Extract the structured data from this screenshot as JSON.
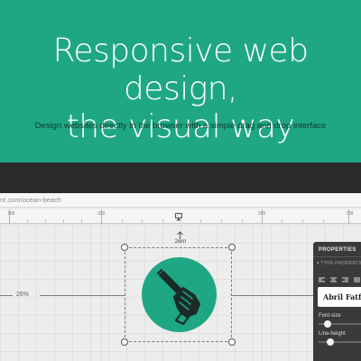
{
  "hero": {
    "title_line1": "Responsive web design,",
    "title_line2": "the visual way",
    "subtitle": "Design websites directly in the browser with a simple drag and drop interface"
  },
  "browser": {
    "url": "nt.com/ocean-beach"
  },
  "ruler": {
    "labels": [
      "768",
      "320",
      "320",
      "768"
    ]
  },
  "canvas": {
    "width_percent": "26%",
    "top_margin": "2em"
  },
  "panel": {
    "header": "PROPERTIES",
    "section": "▾ TYPE PROPERTIES",
    "font_name": "Abril Fatface",
    "font_size_label": "Font-size",
    "line_height_label": "Line-height",
    "font_size_value": 0.12,
    "line_height_value": 0.2
  },
  "colors": {
    "accent": "#1fa783",
    "dark": "#2a2a2a",
    "panel": "#3a3a3a"
  },
  "icons": [
    "monitor-icon",
    "arrow-up-icon",
    "pen-in-hand-logo-icon",
    "align-left-icon",
    "align-center-icon",
    "align-right-icon",
    "align-justify-icon"
  ]
}
